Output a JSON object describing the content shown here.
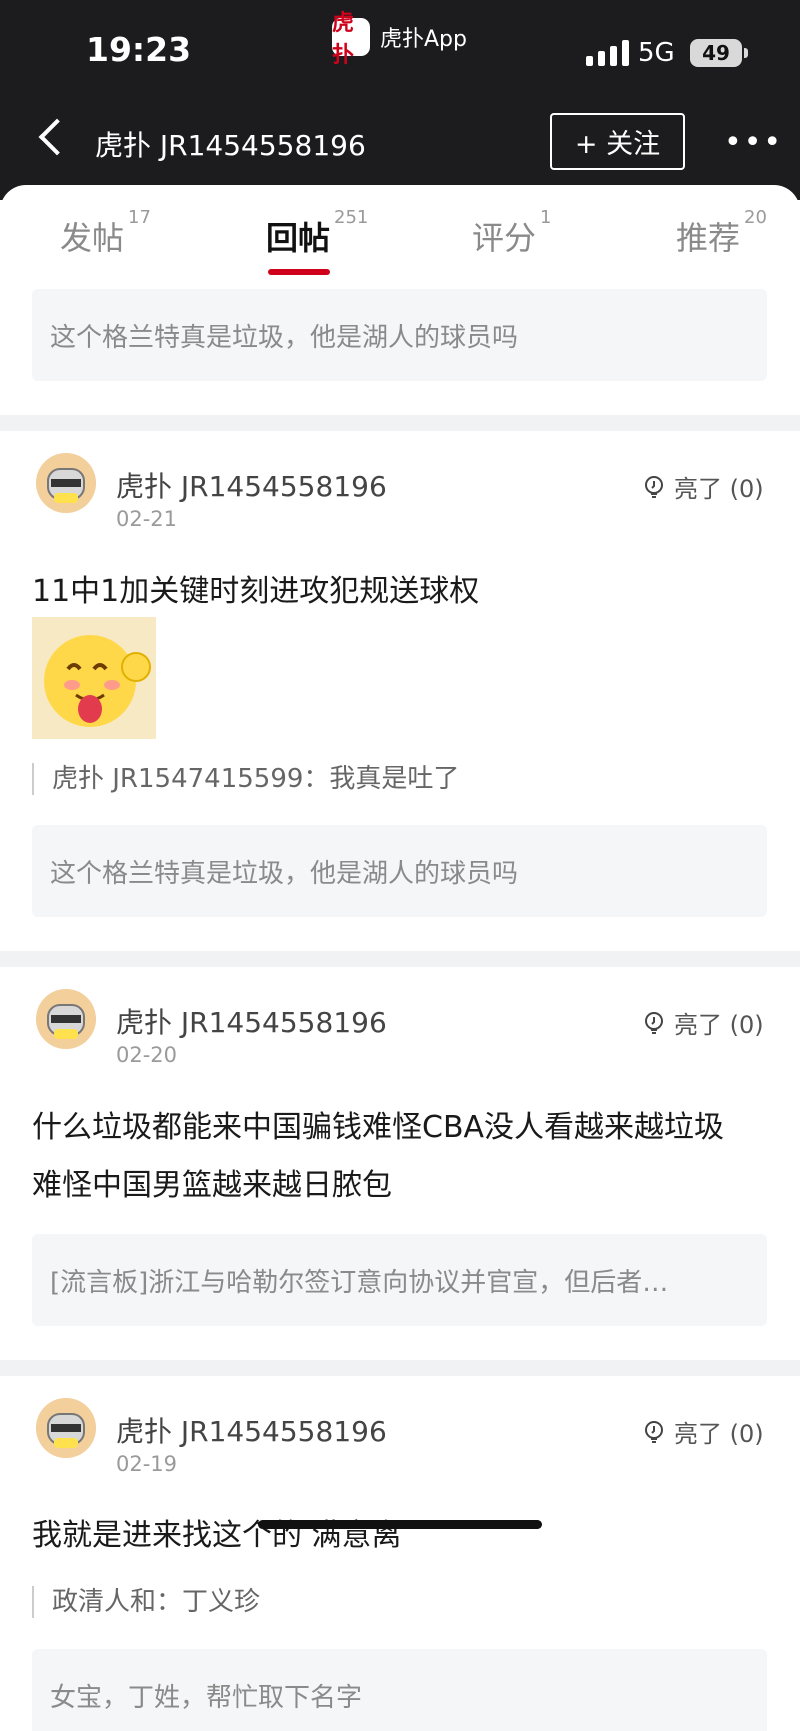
{
  "status_bar": {
    "time": "19:23",
    "network": "5G",
    "battery": "49"
  },
  "app_pill": {
    "logo_text": "虎扑",
    "name": "虎扑App"
  },
  "nav": {
    "title": "虎扑 JR1454558196",
    "follow_label": "+ 关注",
    "more_icon": "more-dots-icon"
  },
  "tabs": [
    {
      "label": "发帖",
      "count": "17"
    },
    {
      "label": "回帖",
      "count": "251",
      "active": true
    },
    {
      "label": "评分",
      "count": "1"
    },
    {
      "label": "推荐",
      "count": "20"
    }
  ],
  "top_quote": "这个格兰特真是垃圾，他是湖人的球员吗",
  "posts": [
    {
      "username": "虎扑 JR1454558196",
      "date": "02-21",
      "light": "亮了 (0)",
      "content": "11中1加关键时刻进攻犯规送球权",
      "sticker": "tongue-out-emoji-sticker",
      "reply": "虎扑 JR1547415599：我真是吐了",
      "quote": "这个格兰特真是垃圾，他是湖人的球员吗"
    },
    {
      "username": "虎扑 JR1454558196",
      "date": "02-20",
      "light": "亮了 (0)",
      "content": "什么垃圾都能来中国骗钱难怪CBA没人看越来越垃圾难怪中国男篮越来越日脓包",
      "quote": "[流言板]浙江与哈勒尔签订意向协议并官宣，但后者…"
    },
    {
      "username": "虎扑 JR1454558196",
      "date": "02-19",
      "light": "亮了 (0)",
      "content": "我就是进来找这个的 满意离",
      "reply": "政清人和：丁义珍",
      "quote": "女宝，丁姓，帮忙取下名字"
    }
  ]
}
